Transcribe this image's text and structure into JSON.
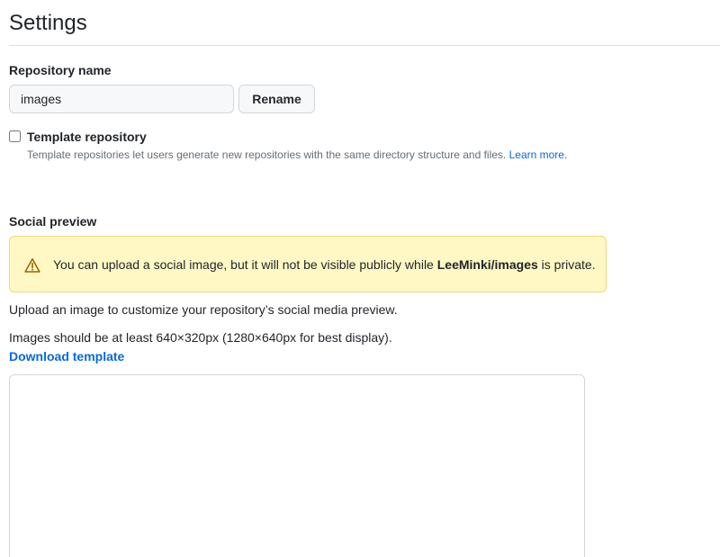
{
  "page": {
    "title": "Settings"
  },
  "repository": {
    "label": "Repository name",
    "name_value": "images",
    "rename_label": "Rename"
  },
  "template": {
    "label": "Template repository",
    "checked": false,
    "description": "Template repositories let users generate new repositories with the same directory structure and files. ",
    "learn_more": "Learn more."
  },
  "social_preview": {
    "label": "Social preview",
    "warning": {
      "icon": "alert-triangle-icon",
      "text_before": "You can upload a social image, but it will not be visible publicly while ",
      "repo": "LeeMinki/images",
      "text_after": " is private."
    },
    "upload_text": "Upload an image to customize your repository’s social media preview.",
    "size_text": "Images should be at least 640×320px (1280×640px for best display).",
    "download_label": "Download template"
  },
  "colors": {
    "accent": "#0969da",
    "warning_bg": "#fff8c5",
    "warning_border": "#f0d77f"
  }
}
